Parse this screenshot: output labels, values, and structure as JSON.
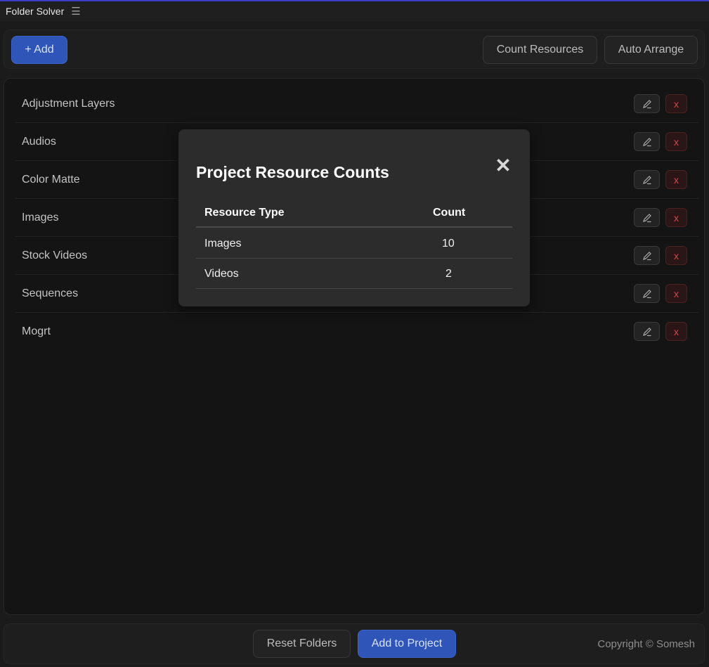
{
  "app": {
    "title": "Folder Solver",
    "menu_icon": "hamburger-menu-icon"
  },
  "toolbar": {
    "add_label": "+ Add",
    "count_label": "Count Resources",
    "arrange_label": "Auto Arrange"
  },
  "folders": [
    {
      "name": "Adjustment Layers"
    },
    {
      "name": "Audios"
    },
    {
      "name": "Color Matte"
    },
    {
      "name": "Images"
    },
    {
      "name": "Stock Videos"
    },
    {
      "name": "Sequences"
    },
    {
      "name": "Mogrt"
    }
  ],
  "row_actions": {
    "edit_icon": "pencil-icon",
    "delete_label": "x"
  },
  "modal": {
    "title": "Project Resource Counts",
    "close_symbol": "✕",
    "headers": {
      "type": "Resource Type",
      "count": "Count"
    },
    "rows": [
      {
        "type": "Images",
        "count": "10"
      },
      {
        "type": "Videos",
        "count": "2"
      }
    ]
  },
  "footer": {
    "reset_label": "Reset Folders",
    "add_project_label": "Add to Project",
    "copyright": "Copyright © Somesh"
  },
  "colors": {
    "accent": "#2f55b8",
    "delete": "#d24b4b",
    "background": "#141414"
  }
}
